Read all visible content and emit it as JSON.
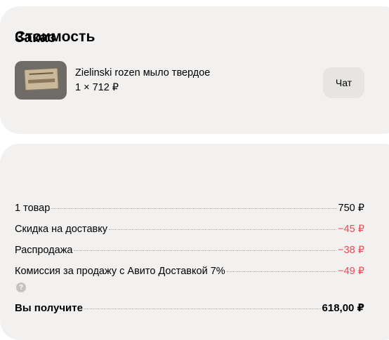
{
  "order": {
    "title": "Заказ",
    "item": {
      "name": "Zielinski rozen мыло твердое",
      "qty_price": "1 × 712 ₽"
    },
    "chat_label": "Чат"
  },
  "cost": {
    "title": "Стоимость",
    "rows": [
      {
        "label": "1 товар",
        "value": "750 ₽"
      },
      {
        "label": "Скидка на доставку",
        "value": "−45 ₽"
      },
      {
        "label": "Распродажа",
        "value": "−38 ₽"
      },
      {
        "label": "Комиссия за продажу с Авито Доставкой 7%",
        "value": "−49 ₽"
      }
    ],
    "help_glyph": "?",
    "total": {
      "label": "Вы получите",
      "value": "618,00 ₽"
    }
  },
  "colors": {
    "card_bg": "#f2f1f0",
    "negative": "#f2474f",
    "chat_button_bg": "#e6e5e3"
  },
  "icons": {
    "help": "question-circle-icon",
    "product": "product-thumbnail-image"
  }
}
